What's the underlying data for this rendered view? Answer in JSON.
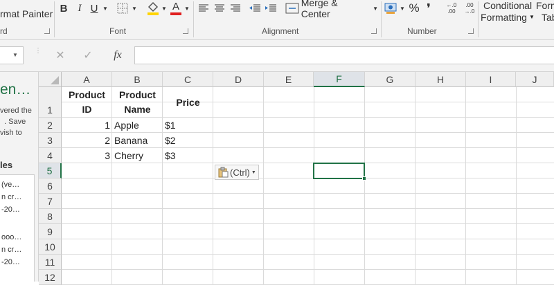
{
  "ribbon": {
    "format_painter": "rmat Painter",
    "clipboard_label": "rd",
    "font_label": "Font",
    "alignment_label": "Alignment",
    "number_label": "Number",
    "merge_center": "Merge & Center",
    "conditional_formatting_1": "Conditional",
    "conditional_formatting_2": "Formatting",
    "format_table_1": "Form",
    "format_table_2": "Tab",
    "bold": "B",
    "italic": "I",
    "underline": "U",
    "font_color_glyph": "A",
    "percent": "%",
    "comma": "❜",
    "inc_decimal": "←.0 .00",
    "dec_decimal": ".00 →.0"
  },
  "formula_bar": {
    "fx": "fx",
    "cancel": "✕",
    "enter": "✓",
    "content": ""
  },
  "side_pane": {
    "title": "en…",
    "text_lines": [
      "vered the",
      ". Save",
      "vish to"
    ],
    "section": "les",
    "items": [
      "(ve…",
      "n cr…",
      "-20…",
      "ooo…",
      "n cr…",
      "-20…"
    ]
  },
  "sheet": {
    "columns": [
      "A",
      "B",
      "C",
      "D",
      "E",
      "F",
      "G",
      "H",
      "I",
      "J"
    ],
    "selected_column": "F",
    "rows": [
      "1",
      "2",
      "3",
      "4",
      "5",
      "6",
      "7",
      "8",
      "9",
      "10",
      "11",
      "12"
    ],
    "selected_row": "5",
    "header": {
      "a_line1": "Product",
      "a_line2": "ID",
      "b_line1": "Product",
      "b_line2": "Name",
      "c": "Price"
    },
    "data": [
      {
        "id": "1",
        "name": "Apple",
        "price": "$1"
      },
      {
        "id": "2",
        "name": "Banana",
        "price": "$2"
      },
      {
        "id": "3",
        "name": "Cherry",
        "price": "$3"
      }
    ],
    "paste_options": "(Ctrl)",
    "active_cell": "F5"
  },
  "colors": {
    "accent": "#217346",
    "font_color_bar": "#e02020",
    "fill_color_bar": "#ffd400"
  }
}
